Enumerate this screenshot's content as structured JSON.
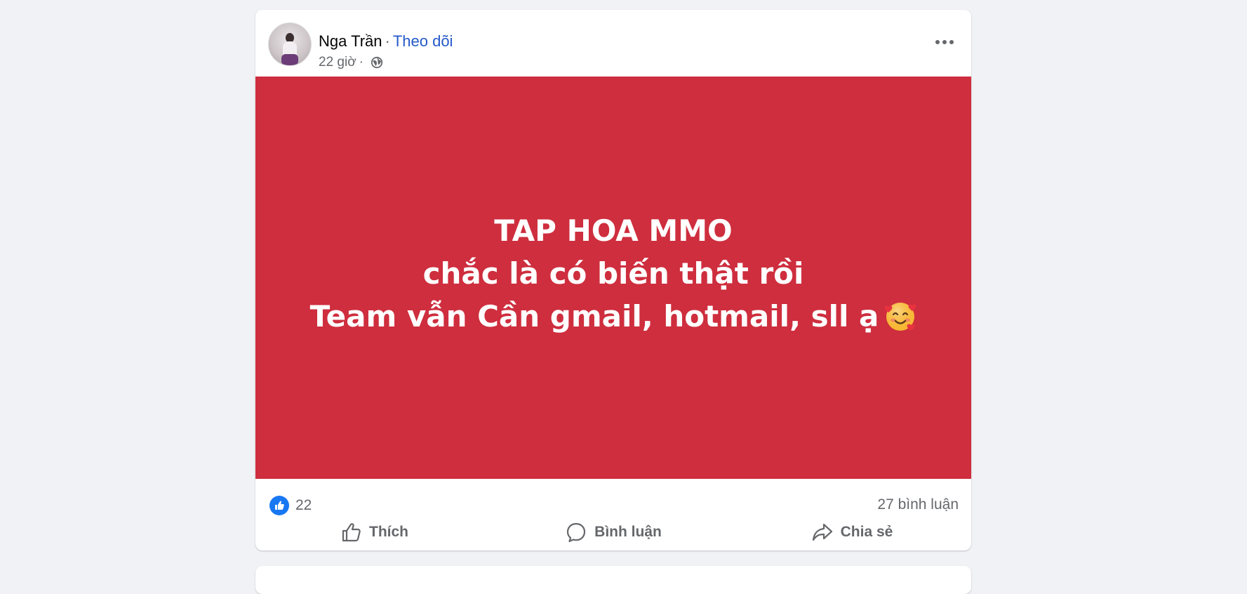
{
  "post": {
    "author": {
      "name": "Nga Trần",
      "separator": "·",
      "follow_label": "Theo dõi"
    },
    "time": "22 giờ",
    "time_separator": "·",
    "audience_icon": "globe-icon",
    "more_icon": "more-options-icon",
    "background_color": "#ce2e3e",
    "text_lines": [
      "TAP HOA MMO",
      "chắc là có biến thật rồi",
      "Team vẫn Cần gmail, hotmail, sll ạ"
    ],
    "emoji_icon": "smiling-face-with-hearts-emoji",
    "reactions": {
      "icon": "like-reaction-icon",
      "count": "22"
    },
    "comment_count": "27 bình luận",
    "actions": {
      "like_label": "Thích",
      "comment_label": "Bình luận",
      "share_label": "Chia sẻ"
    }
  }
}
